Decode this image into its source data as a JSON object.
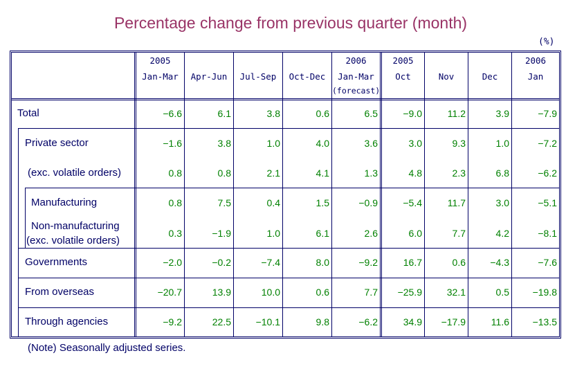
{
  "title": "Percentage change from previous quarter (month)",
  "unit": "(%)",
  "note": "(Note) Seasonally adjusted series.",
  "columns": [
    {
      "year": "2005",
      "period": "Jan-Mar",
      "sub": ""
    },
    {
      "year": "",
      "period": "Apr-Jun",
      "sub": ""
    },
    {
      "year": "",
      "period": "Jul-Sep",
      "sub": ""
    },
    {
      "year": "",
      "period": "Oct-Dec",
      "sub": ""
    },
    {
      "year": "2006",
      "period": "Jan-Mar",
      "sub": "(forecast)"
    },
    {
      "year": "2005",
      "period": "Oct",
      "sub": ""
    },
    {
      "year": "",
      "period": "Nov",
      "sub": ""
    },
    {
      "year": "",
      "period": "Dec",
      "sub": ""
    },
    {
      "year": "2006",
      "period": "Jan",
      "sub": ""
    }
  ],
  "rows": [
    {
      "label": "Total",
      "values": [
        "-6.6",
        "6.1",
        "3.8",
        "0.6",
        "6.5",
        "-9.0",
        "11.2",
        "3.9",
        "-7.9"
      ]
    },
    {
      "label": "Private sector",
      "values": [
        "-1.6",
        "3.8",
        "1.0",
        "4.0",
        "3.6",
        "3.0",
        "9.3",
        "1.0",
        "-7.2"
      ]
    },
    {
      "label": "(exc. volatile orders)",
      "values": [
        "0.8",
        "0.8",
        "2.1",
        "4.1",
        "1.3",
        "4.8",
        "2.3",
        "6.8",
        "-6.2"
      ]
    },
    {
      "label": "Manufacturing",
      "values": [
        "0.8",
        "7.5",
        "0.4",
        "1.5",
        "-0.9",
        "-5.4",
        "11.7",
        "3.0",
        "-5.1"
      ]
    },
    {
      "label": "Non-manufacturing",
      "label2": "(exc. volatile orders)",
      "values": [
        "0.3",
        "-1.9",
        "1.0",
        "6.1",
        "2.6",
        "6.0",
        "7.7",
        "4.2",
        "-8.1"
      ]
    },
    {
      "label": "Governments",
      "values": [
        "-2.0",
        "-0.2",
        "-7.4",
        "8.0",
        "-9.2",
        "16.7",
        "0.6",
        "-4.3",
        "-7.6"
      ]
    },
    {
      "label": "From overseas",
      "values": [
        "-20.7",
        "13.9",
        "10.0",
        "0.6",
        "7.7",
        "-25.9",
        "32.1",
        "0.5",
        "-19.8"
      ]
    },
    {
      "label": "Through agencies",
      "values": [
        "-9.2",
        "22.5",
        "-10.1",
        "9.8",
        "-6.2",
        "34.9",
        "-17.9",
        "11.6",
        "-13.5"
      ]
    }
  ],
  "colors": {
    "title": "#993366",
    "text": "#000066",
    "values": "#008000",
    "border": "#000066"
  }
}
